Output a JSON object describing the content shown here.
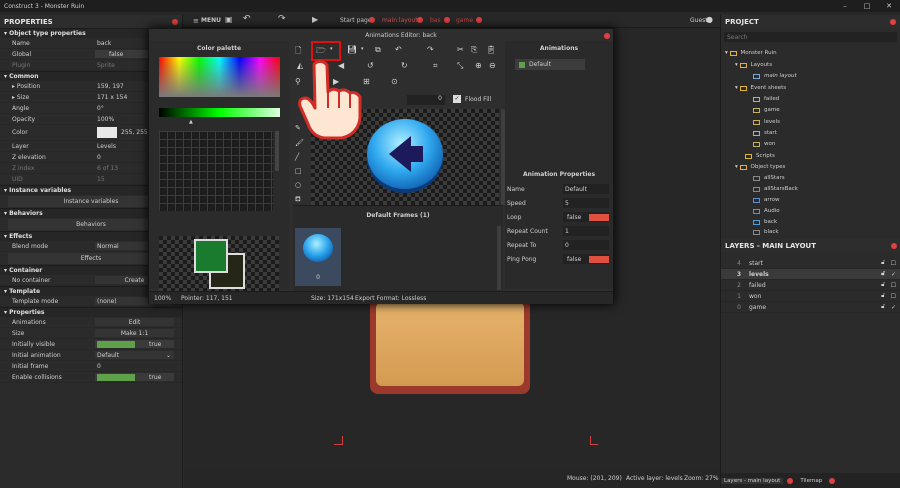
{
  "window": {
    "title": "Construct 3 - Monster Ruin"
  },
  "menubar": {
    "menu": "MENU",
    "tabs": [
      {
        "label": "Start page"
      },
      {
        "label": "main layout"
      },
      {
        "label": "bas"
      },
      {
        "label": "game"
      }
    ],
    "guest": "Guest"
  },
  "properties": {
    "title": "PROPERTIES",
    "s1": "Object type properties",
    "name_k": "Name",
    "name_v": "back",
    "global_k": "Global",
    "global_v": "false",
    "plugin_k": "Plugin",
    "plugin_v": "Sprite",
    "s2": "Common",
    "pos_k": "Position",
    "pos_v": "159, 197",
    "size_k": "Size",
    "size_v": "171 x 154",
    "angle_k": "Angle",
    "angle_v": "0°",
    "opacity_k": "Opacity",
    "opacity_v": "100%",
    "color_k": "Color",
    "color_v": "255, 255,",
    "layer_k": "Layer",
    "layer_v": "Levels",
    "zel_k": "Z elevation",
    "zel_v": "0",
    "zidx_k": "Z index",
    "zidx_v": "6 of 13",
    "uid_k": "UID",
    "uid_v": "15",
    "s3": "Instance variables",
    "s3_btn": "Instance variables",
    "s4": "Behaviors",
    "s4_btn": "Behaviors",
    "s5": "Effects",
    "blend_k": "Blend mode",
    "blend_v": "Normal",
    "s5_btn": "Effects",
    "s6": "Container",
    "nocont_k": "No container",
    "nocont_v": "Create",
    "s7": "Template",
    "tmode_k": "Template mode",
    "tmode_v": "(none)",
    "s8": "Properties",
    "anim_k": "Animations",
    "anim_v": "Edit",
    "psize_k": "Size",
    "psize_v": "Make 1:1",
    "vis_k": "Initially visible",
    "vis_v": "true",
    "ianim_k": "Initial animation",
    "ianim_v": "Default",
    "iframe_k": "Initial frame",
    "iframe_v": "0",
    "coll_k": "Enable collisions",
    "coll_v": "true"
  },
  "dialog": {
    "title": "Animations Editor: back",
    "palette_title": "Color palette",
    "zoom": "100%",
    "pointer": "Pointer: 117, 151",
    "outline_val": "0",
    "flood": "Flood Fill",
    "frames_title": "Default Frames (1)",
    "frame_index": "0",
    "size_info": "Size: 171x154",
    "export_info": "Export Format: Lossless",
    "animations_title": "Animations",
    "animation_item": "Default",
    "ap_title": "Animation Properties",
    "ap_rows": [
      {
        "k": "Name",
        "v": "Default"
      },
      {
        "k": "Speed",
        "v": "5"
      },
      {
        "k": "Loop",
        "v": "false"
      },
      {
        "k": "Repeat Count",
        "v": "1"
      },
      {
        "k": "Repeat To",
        "v": "0"
      },
      {
        "k": "Ping Pong",
        "v": "false"
      }
    ]
  },
  "project": {
    "title": "PROJECT",
    "search_placeholder": "Search",
    "root": "Monster Ruin",
    "layouts": "Layouts",
    "main_layout": "main layout",
    "event_sheets": "Event sheets",
    "sheets": [
      "failed",
      "game",
      "levels",
      "start",
      "won"
    ],
    "scripts": "Scripts",
    "object_types": "Object types",
    "objects": [
      "allStars",
      "allStarsBack",
      "arrow",
      "Audio",
      "back",
      "black"
    ]
  },
  "layers": {
    "title": "LAYERS - MAIN LAYOUT",
    "rows": [
      {
        "n": "4",
        "name": "start"
      },
      {
        "n": "3",
        "name": "levels"
      },
      {
        "n": "2",
        "name": "failed"
      },
      {
        "n": "1",
        "name": "won"
      },
      {
        "n": "0",
        "name": "game"
      }
    ]
  },
  "footer": {
    "tab1": "Layers - main layout",
    "tab2": "Tilemap"
  },
  "status": {
    "mouse": "Mouse: (201, 209)",
    "active": "Active layer: levels",
    "zoom": "Zoom: 27%"
  }
}
